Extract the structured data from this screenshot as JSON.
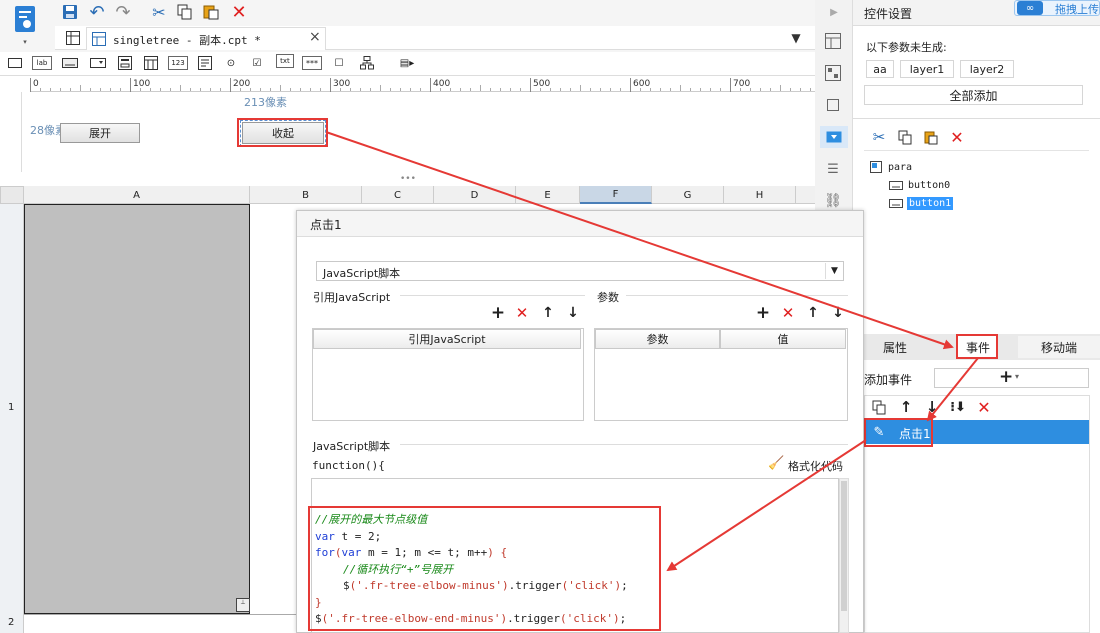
{
  "tab": {
    "title": "singletree - 副本.cpt *",
    "close": "×"
  },
  "canvas": {
    "ruler_ticks": [
      "0",
      "100",
      "200",
      "300",
      "400",
      "500",
      "600",
      "700"
    ],
    "coord_x": "213像素",
    "coord_y": "28像素",
    "btn_expand": "展开",
    "btn_collapse": "收起"
  },
  "widget_labels": {
    "lab": "lab",
    "num": "123",
    "txt": "txt",
    "pwd": "***"
  },
  "sheet": {
    "columns": [
      "A",
      "B",
      "C",
      "D",
      "E",
      "F",
      "G",
      "H"
    ],
    "rows": [
      "1",
      "2"
    ]
  },
  "dialog": {
    "title": "点击1",
    "type_select": "JavaScript脚本",
    "ref_js_label": "引用JavaScript",
    "params_label": "参数",
    "ref_js_header": "引用JavaScript",
    "param_col": "参数",
    "value_col": "值",
    "script_label": "JavaScript脚本",
    "func_sig": "function(){",
    "format_label": "格式化代码",
    "code": [
      {
        "t": "//展开的最大节点级值",
        "c": "comment",
        "i": 0
      },
      {
        "t": "var t = 2;",
        "c": "kw",
        "i": 0
      },
      {
        "t": "for(var m = 1; m <= t; m++) {",
        "c": "kw",
        "i": 0
      },
      {
        "t": "//循环执行“+”号展开",
        "c": "comment",
        "i": 1
      },
      {
        "t": "$('.fr-tree-elbow-minus').trigger('click');",
        "c": "code",
        "i": 1
      },
      {
        "t": "}",
        "c": "code",
        "i": 0
      },
      {
        "t": "$('.fr-tree-elbow-end-minus').trigger('click');",
        "c": "code",
        "i": 0
      }
    ]
  },
  "right_panel": {
    "title": "控件设置",
    "top_btn": "拖拽上传",
    "not_generated": "以下参数未生成:",
    "params": [
      "aa",
      "layer1",
      "layer2"
    ],
    "add_all": "全部添加",
    "tree": {
      "root": "para",
      "children": [
        "button0",
        "button1"
      ]
    },
    "tabs": [
      "属性",
      "事件",
      "移动端"
    ],
    "add_event": "添加事件",
    "event_item": "点击1"
  },
  "colors": {
    "accent": "#3399ff",
    "annotation": "#e53935",
    "selected": "#2e8ee0"
  }
}
